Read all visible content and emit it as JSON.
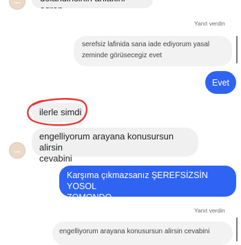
{
  "conversation": {
    "top_partial": "dolandiricinin ahlakini ogren",
    "reply_label_1": "Yanıt verdin",
    "reply_quote_1_line1": "serefsiz lafinida sana iade ediyorum yasal",
    "reply_quote_1_line2": "zeminde görüsecegiz evet",
    "outgoing_evet": "Evet",
    "incoming_ilerle": "ilerle simdi",
    "incoming_engelli_line1": "engelliyorum arayana konusursun alirsin",
    "incoming_engelli_line2": "cevabini",
    "outgoing_long_line1": "Karşıma çıkmazsanız ŞEREFSİZSİN YOSOL",
    "outgoing_long_line2": "ZOMONDO",
    "reply_label_2": "Yanıt verdin",
    "reply_quote_2": "engelliyorum arayana konusursun alirsin cevabini"
  },
  "colors": {
    "outgoing_bubble": "#2f64f2",
    "incoming_bubble": "#f0f0f0",
    "highlight_circle": "#e53935"
  }
}
